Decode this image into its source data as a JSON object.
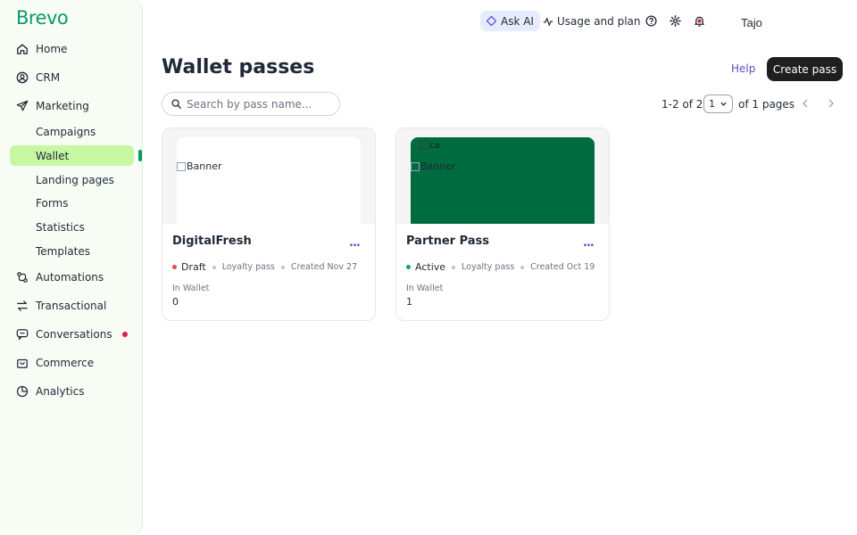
{
  "brand": {
    "logo_text": "Brevo",
    "accent": "#0b996e"
  },
  "sidebar": {
    "items": [
      {
        "label": "Home",
        "icon": "home-icon"
      },
      {
        "label": "CRM",
        "icon": "contacts-icon"
      },
      {
        "label": "Marketing",
        "icon": "send-icon"
      },
      {
        "label": "Automations",
        "icon": "automation-icon"
      },
      {
        "label": "Transactional",
        "icon": "transfer-icon"
      },
      {
        "label": "Conversations",
        "icon": "chat-icon"
      },
      {
        "label": "Commerce",
        "icon": "bag-icon"
      },
      {
        "label": "Analytics",
        "icon": "pie-chart-icon"
      }
    ],
    "marketing_sub": [
      {
        "label": "Campaigns"
      },
      {
        "label": "Wallet"
      },
      {
        "label": "Landing pages"
      },
      {
        "label": "Forms"
      },
      {
        "label": "Statistics"
      },
      {
        "label": "Templates"
      }
    ],
    "active_sub": "Wallet",
    "active_color": "#c7f7a2"
  },
  "topbar": {
    "ask_ai": "Ask AI",
    "usage": "Usage and plan",
    "user_name": "Tajo"
  },
  "header": {
    "title": "Wallet passes",
    "help": "Help",
    "create": "Create pass"
  },
  "search": {
    "placeholder": "Search by pass name...",
    "value": ""
  },
  "pagination": {
    "range": "1-2 of 2",
    "page": "1",
    "of_pages": "of 1 pages"
  },
  "cards": [
    {
      "name": "DigitalFresh",
      "banner_alt": "Banner",
      "banner_color": "#ffffff",
      "status": "Draft",
      "status_color": "#e5484d",
      "type": "Loyalty pass",
      "created": "Created Nov 27",
      "wallet_label": "In Wallet",
      "wallet_count": "0",
      "more": "..."
    },
    {
      "name": "Partner Pass",
      "banner_alt": "Banner",
      "logo_alt": "car",
      "banner_color": "#006b3f",
      "status": "Active",
      "status_color": "#12a37a",
      "type": "Loyalty pass",
      "created": "Created Oct 19",
      "wallet_label": "In Wallet",
      "wallet_count": "1",
      "more": "..."
    }
  ]
}
